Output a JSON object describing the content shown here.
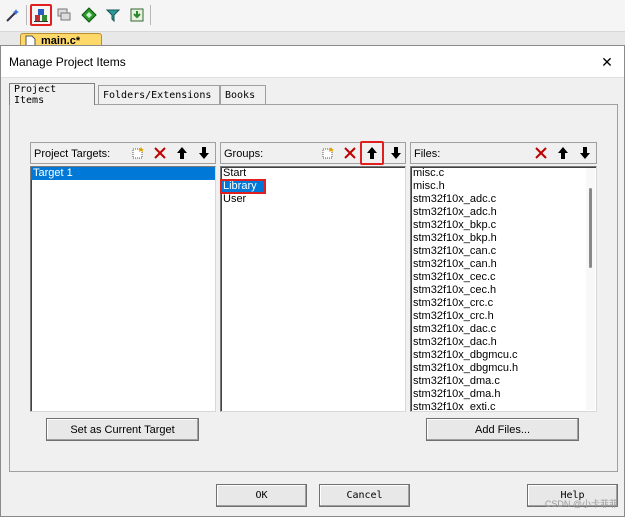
{
  "toolbar": {
    "icons": [
      "wand-icon",
      "project-items-icon",
      "window-stack-icon",
      "green-diamond-icon",
      "funnel-icon",
      "download-icon"
    ]
  },
  "editor_tab": {
    "label": "main.c*"
  },
  "dialog": {
    "title": "Manage Project Items",
    "close_glyph": "✕",
    "tabs": [
      "Project Items",
      "Folders/Extensions",
      "Books"
    ],
    "targets": {
      "label": "Project Targets:",
      "items": [
        "Target 1"
      ],
      "selected": 0
    },
    "groups": {
      "label": "Groups:",
      "items": [
        "Start",
        "Library",
        "User"
      ],
      "selected": 1
    },
    "files": {
      "label": "Files:",
      "items": [
        "misc.c",
        "misc.h",
        "stm32f10x_adc.c",
        "stm32f10x_adc.h",
        "stm32f10x_bkp.c",
        "stm32f10x_bkp.h",
        "stm32f10x_can.c",
        "stm32f10x_can.h",
        "stm32f10x_cec.c",
        "stm32f10x_cec.h",
        "stm32f10x_crc.c",
        "stm32f10x_crc.h",
        "stm32f10x_dac.c",
        "stm32f10x_dac.h",
        "stm32f10x_dbgmcu.c",
        "stm32f10x_dbgmcu.h",
        "stm32f10x_dma.c",
        "stm32f10x_dma.h",
        "stm32f10x_exti.c"
      ]
    },
    "set_current_target": "Set as Current Target",
    "add_files": "Add Files...",
    "ok": "OK",
    "cancel": "Cancel",
    "help": "Help",
    "watermark": "CSDN @小卡菲菲"
  },
  "colors": {
    "selection": "#0078d7",
    "highlight_box": "#e02020",
    "tab_yellow": "#ffd86a"
  }
}
